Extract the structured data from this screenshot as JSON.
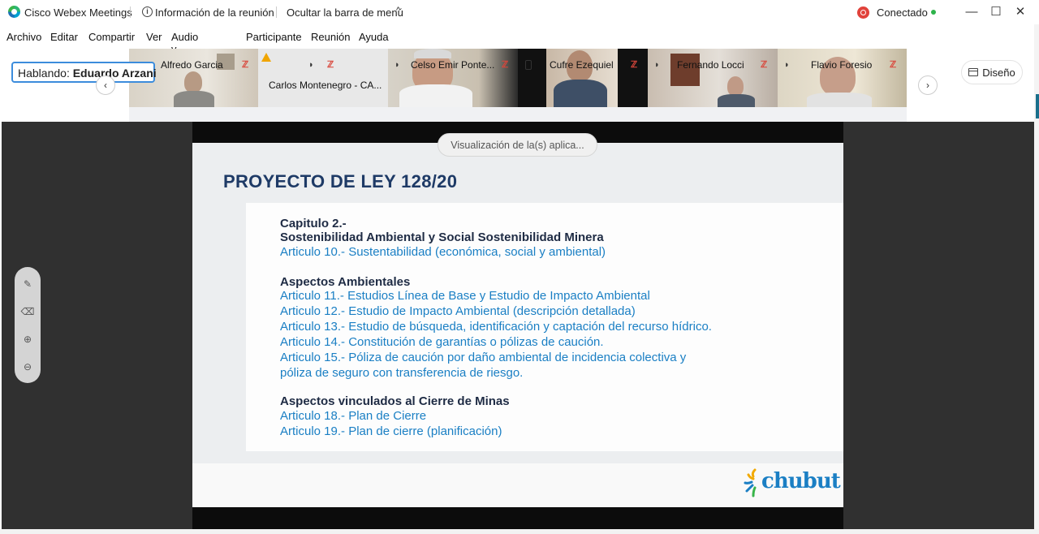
{
  "window": {
    "app_title": "Cisco Webex Meetings",
    "meeting_info": "Información de la reunión",
    "hide_menu": "Ocultar la barra de menú",
    "hide_menu_chevron": "^",
    "status": "Conectado",
    "controls": {
      "minimize": "—",
      "maximize": "☐",
      "close": "✕"
    }
  },
  "menu": [
    "Archivo",
    "Editar",
    "Compartir",
    "Ver",
    "Audio y vídeo",
    "Participante",
    "Reunión",
    "Ayuda"
  ],
  "speaking": {
    "prefix": "Hablando:",
    "name": "Eduardo Arzani"
  },
  "participants": [
    {
      "name": "Alfredo Garcia"
    },
    {
      "name": "Carlos Montenegro - CA..."
    },
    {
      "name": "Celso Emir Ponte..."
    },
    {
      "name": "Cufre Ezequiel"
    },
    {
      "name": "Fernando Locci"
    },
    {
      "name": "Flavio Foresio"
    }
  ],
  "nav": {
    "prev": "‹",
    "next": "›"
  },
  "layout_button": "Diseño",
  "app_pill": "Visualización de la(s) aplica...",
  "slide": {
    "title": "PROYECTO DE LEY 128/20",
    "lines": [
      {
        "text": "Capitulo 2.-",
        "style": "dark"
      },
      {
        "text": "Sostenibilidad Ambiental y Social Sostenibilidad Minera",
        "style": "dark"
      },
      {
        "text": "Articulo 10.- Sustentabilidad (económica, social y ambiental)",
        "style": "blue"
      },
      {
        "text": "Aspectos Ambientales",
        "style": "dark"
      },
      {
        "text": "Articulo 11.- Estudios Línea de Base y Estudio de Impacto Ambiental",
        "style": "blue"
      },
      {
        "text": "Articulo 12.- Estudio de Impacto Ambiental (descripción detallada)",
        "style": "blue"
      },
      {
        "text": "Articulo 13.- Estudio de búsqueda, identificación y captación del recurso hídrico.",
        "style": "blue"
      },
      {
        "text": "Articulo 14.- Constitución de garantías o pólizas de caución.",
        "style": "blue"
      },
      {
        "text": "Articulo 15.- Póliza de caución por daño ambiental de incidencia colectiva y",
        "style": "blue"
      },
      {
        "text": "póliza de seguro con transferencia de riesgo.",
        "style": "blue"
      },
      {
        "text": "Aspectos vinculados al Cierre de Minas",
        "style": "dark"
      },
      {
        "text": "Articulo 18.- Plan de Cierre",
        "style": "blue"
      },
      {
        "text": "Articulo 19.- Plan de cierre (planificación)",
        "style": "blue"
      }
    ],
    "logo_text": "chubut"
  },
  "colors": {
    "accent": "#3c8cdc",
    "slide_title": "#1e3a66",
    "slide_blue": "#1a7fc4",
    "status_green": "#2db34a",
    "mute_red": "#d9463b"
  }
}
